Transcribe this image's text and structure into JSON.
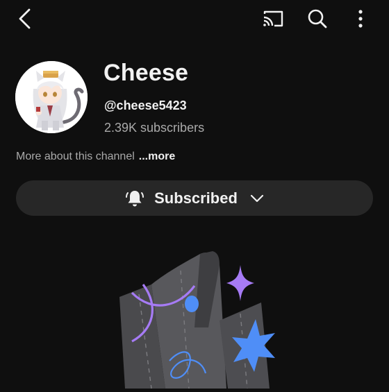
{
  "topbar": {
    "icons": [
      "back-arrow-icon",
      "cast-icon",
      "search-icon",
      "more-vertical-icon"
    ]
  },
  "channel": {
    "name": "Cheese",
    "handle": "@cheese5423",
    "subscribers": "2.39K subscribers",
    "about_text": "More about this channel",
    "about_more": "...more",
    "avatar_icon": "anime-character-avatar"
  },
  "subscribe_button": {
    "label": "Subscribed",
    "icon": "bell-ringing-icon",
    "dropdown_icon": "chevron-down-icon"
  },
  "colors": {
    "background": "#0f0f0f",
    "text_primary": "#f1f1f1",
    "text_secondary": "#aaaaaa",
    "button_bg": "#272727",
    "accent_purple": "#a67bf5",
    "accent_blue": "#4f8ef7"
  }
}
